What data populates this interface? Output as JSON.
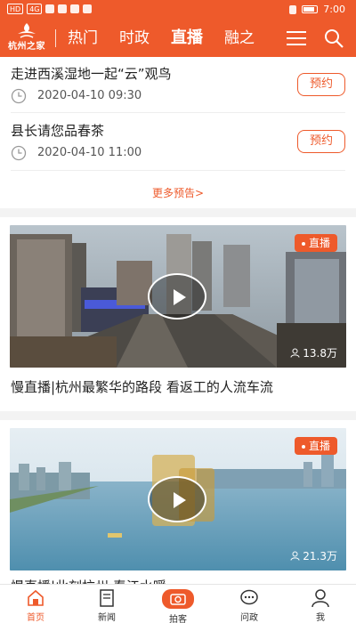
{
  "status_bar": {
    "time": "7:00",
    "battery": ""
  },
  "header": {
    "logo_text": "杭州之家",
    "tabs": [
      {
        "label": "热门",
        "active": false
      },
      {
        "label": "时政",
        "active": false
      },
      {
        "label": "直播",
        "active": true
      },
      {
        "label": "融之",
        "active": false
      }
    ]
  },
  "previews": [
    {
      "title": "走进西溪湿地一起“云”观鸟",
      "time": "2020-04-10 09:30",
      "button": "预约"
    },
    {
      "title": "县长请您品春茶",
      "time": "2020-04-10 11:00",
      "button": "预约"
    }
  ],
  "more_link": "更多预告>",
  "videos": [
    {
      "badge": "直播",
      "viewers": "13.8万",
      "title": "慢直播|杭州最繁华的路段 看返工的人流车流"
    },
    {
      "badge": "直播",
      "viewers": "21.3万",
      "title": "慢直播|此刻杭州 春江水暖"
    }
  ],
  "bottom_nav": [
    {
      "label": "首页",
      "icon": "home-icon",
      "active": true
    },
    {
      "label": "新闻",
      "icon": "news-icon",
      "active": false
    },
    {
      "label": "拍客",
      "icon": "camera-icon",
      "active": false
    },
    {
      "label": "问政",
      "icon": "chat-icon",
      "active": false
    },
    {
      "label": "我",
      "icon": "user-icon",
      "active": false
    }
  ],
  "colors": {
    "brand": "#ee5a2b"
  }
}
